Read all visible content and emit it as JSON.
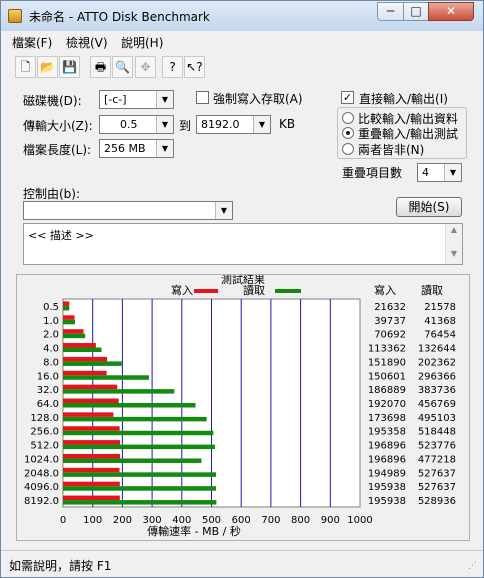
{
  "window": {
    "title": "未命名 - ATTO Disk Benchmark",
    "buttons": {
      "minimize": "─",
      "maximize": "□",
      "close": "✕"
    }
  },
  "menu": [
    "檔案(F)",
    "檢視(V)",
    "說明(H)"
  ],
  "toolbar": {
    "icons": [
      "new-file-icon",
      "open-folder-icon",
      "save-icon",
      "print-icon",
      "print-preview-icon",
      "move-icon",
      "help-icon",
      "context-help-icon"
    ],
    "glyphs": [
      "🗋",
      "📂",
      "💾",
      "🖶",
      "🔍",
      "✥",
      "?",
      "↖?"
    ]
  },
  "form": {
    "drive_label": "磁碟機(D):",
    "drive_value": "[-c-]",
    "force_write_label": "強制寫入存取(A)",
    "direct_io_label": "直接輸入/輸出(I)",
    "transfer_label": "傳輸大小(Z):",
    "transfer_from": "0.5",
    "to_label": "到",
    "transfer_to": "8192.0",
    "kb_label": "KB",
    "length_label": "檔案長度(L):",
    "length_value": "256 MB",
    "compare_label": "比較輸入/輸出資料",
    "overlap_label": "重疊輸入/輸出測試",
    "neither_label": "兩者皆非(N)",
    "queue_label": "重疊項目數",
    "queue_value": "4",
    "controlled_label": "控制由(b):",
    "controlled_value": "",
    "start_button": "開始(S)",
    "description": "<< 描述 >>"
  },
  "status": "如需說明，請按 F1",
  "chart_data": {
    "type": "bar",
    "title": "測試結果",
    "legend": [
      {
        "name": "寫入",
        "color": "#e8141c"
      },
      {
        "name": "讀取",
        "color": "#138a10"
      }
    ],
    "categories": [
      "0.5",
      "1.0",
      "2.0",
      "4.0",
      "8.0",
      "16.0",
      "32.0",
      "64.0",
      "128.0",
      "256.0",
      "512.0",
      "1024.0",
      "2048.0",
      "4096.0",
      "8192.0"
    ],
    "series": [
      {
        "name": "寫入",
        "values": [
          21632,
          39737,
          70692,
          113362,
          151890,
          150601,
          186889,
          192070,
          173698,
          195358,
          196896,
          196896,
          194989,
          195938,
          195938
        ]
      },
      {
        "name": "讀取",
        "values": [
          21578,
          41368,
          76454,
          132644,
          202362,
          296366,
          383736,
          456769,
          495103,
          518448,
          523776,
          477218,
          527637,
          527637,
          528936
        ]
      }
    ],
    "table_headers": {
      "write": "寫入",
      "read": "讀取"
    },
    "xlabel": "傳輸速率 - MB / 秒",
    "xticks": [
      "0",
      "100",
      "200",
      "300",
      "400",
      "500",
      "600",
      "700",
      "800",
      "900",
      "1000"
    ],
    "xlim": [
      0,
      1000
    ],
    "colors": {
      "write": "#e8141c",
      "read": "#138a10",
      "grid": "#1a1ab4"
    }
  }
}
